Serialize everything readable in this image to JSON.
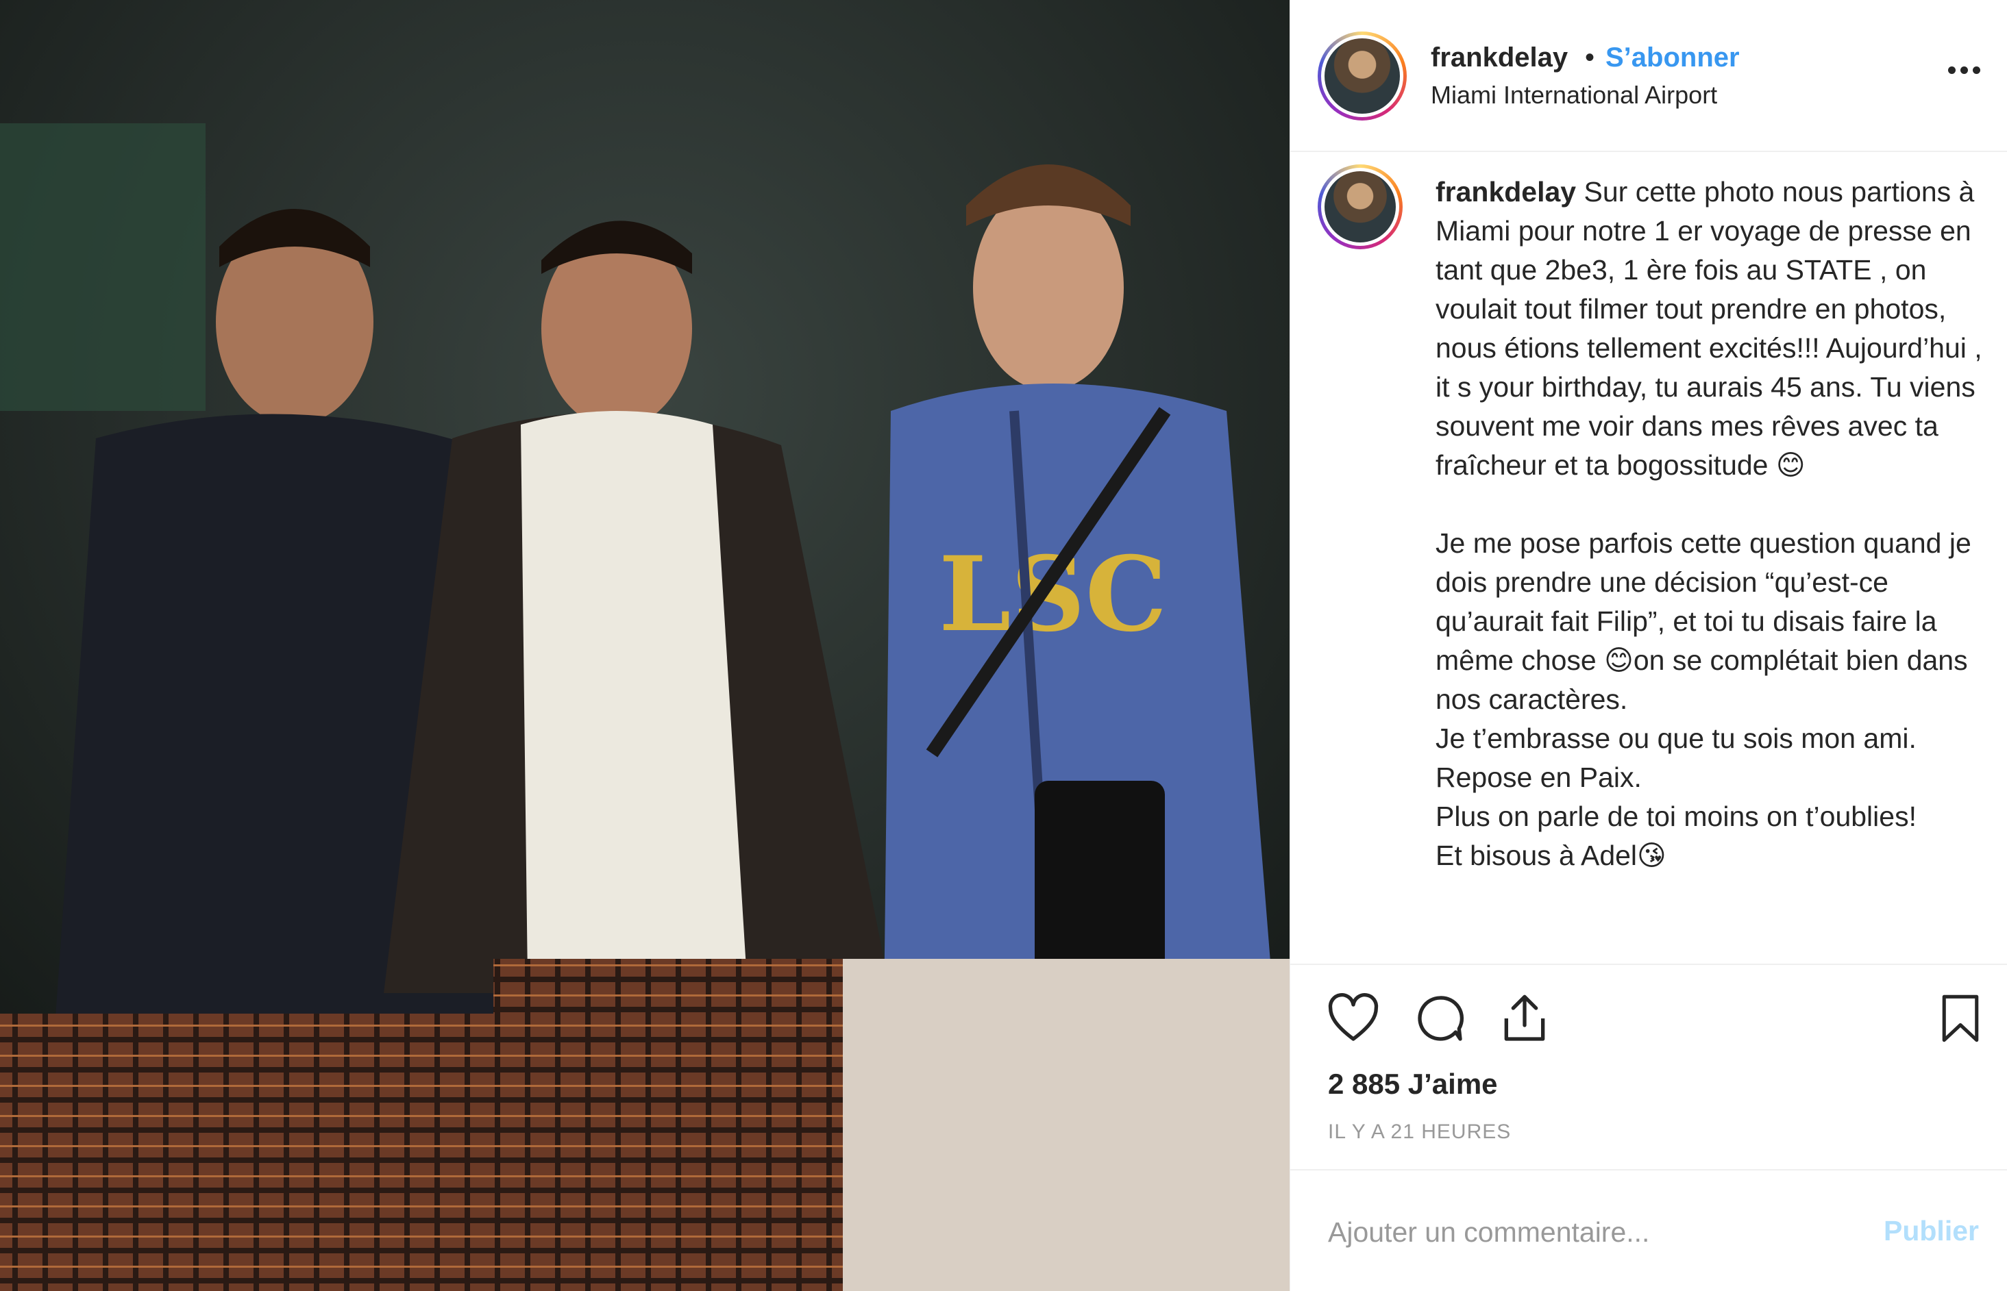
{
  "post": {
    "username": "frankdelay",
    "separator": "•",
    "follow_label": "S’abonner",
    "location": "Miami International Airport",
    "caption_text": " Sur cette photo nous partions à Miami pour notre 1 er voyage de presse en tant que 2be3, 1 ère fois au STATE , on voulait tout filmer tout prendre en photos, nous étions tellement excités!!! Aujourd’hui , it s your birthday, tu aurais 45 ans. Tu viens souvent me voir dans mes rêves avec ta fraîcheur et ta bogossitude 😊\n\nJe me pose parfois cette question quand je dois prendre une décision “qu’est-ce qu’aurait fait Filip”, et toi tu disais faire la même chose 😊on se complétait bien dans nos caractères.\nJe t’embrasse ou que tu sois mon ami.\nRepose en Paix.\nPlus on parle de toi moins on t’oublies!\nEt bisous à Adel😘",
    "likes": "2 885 J’aime",
    "time_ago": "IL Y A 21 HEURES"
  },
  "comment": {
    "placeholder": "Ajouter un commentaire...",
    "publish_label": "Publier"
  },
  "icons": {
    "more": "more-options-icon",
    "like": "heart-icon",
    "comment": "comment-icon",
    "share": "share-icon",
    "save": "bookmark-icon"
  },
  "colors": {
    "link_blue": "#3897f0",
    "publish_disabled": "#b2dffc",
    "muted": "#999999",
    "text": "#262626"
  }
}
